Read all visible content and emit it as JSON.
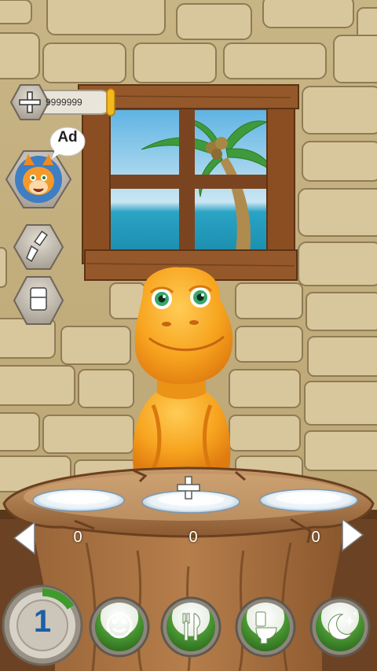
{
  "hud": {
    "coins": "9999999",
    "ad_label": "Ad",
    "level": "1"
  },
  "food_plates": [
    {
      "count": "0"
    },
    {
      "count": "0"
    },
    {
      "count": "0"
    }
  ],
  "bottom_nav": [
    {
      "icon": "level-icon"
    },
    {
      "icon": "smiley-icon"
    },
    {
      "icon": "fork-knife-icon"
    },
    {
      "icon": "toilet-icon"
    },
    {
      "icon": "moon-stars-icon"
    }
  ],
  "colors": {
    "wall": "#cdbb8e",
    "wood": "#8a4e22",
    "dino": "#f5a020",
    "sky": "#7cc3e8",
    "sea": "#2ea8c8",
    "nav_green": "#3f8f2d"
  }
}
